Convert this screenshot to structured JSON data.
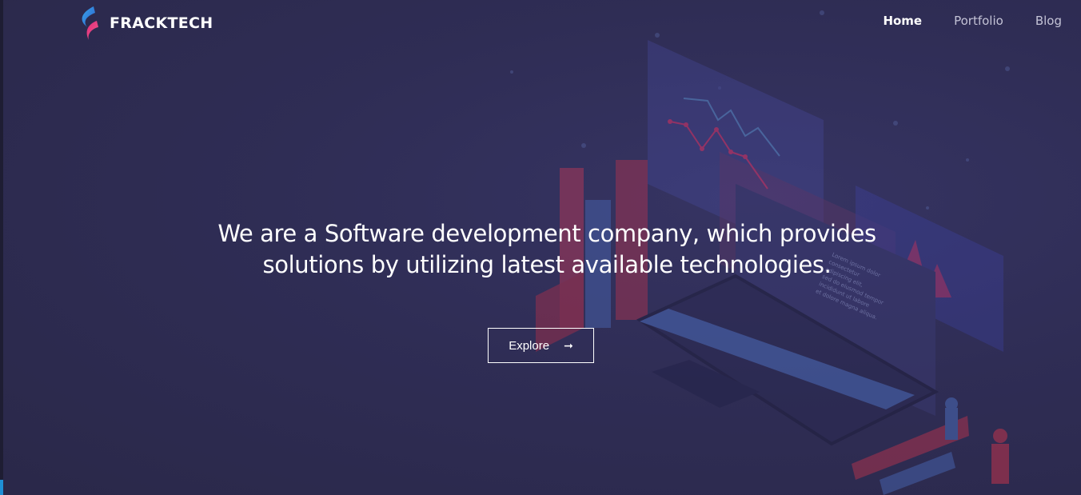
{
  "brand": {
    "name": "FRACKTECH",
    "colors": {
      "background": "#2d2b4e",
      "accent_blue": "#2b7bd6",
      "accent_pink": "#e0246a"
    }
  },
  "nav": {
    "items": [
      {
        "label": "Home",
        "active": true
      },
      {
        "label": "Portfolio",
        "active": false
      },
      {
        "label": "Blog",
        "active": false
      }
    ]
  },
  "hero": {
    "line1": "We are a Software development company, which provides",
    "line2": "solutions by utilizing latest available technologies.",
    "cta_label": "Explore",
    "cta_icon": "arrow-right-icon"
  },
  "illustration": {
    "name": "isometric-laptop-analytics",
    "screen_text": [
      "Lorem ipsum dolor",
      "consectetur",
      "adipiscing elit,",
      "sed do eiusmod tempor",
      "incididunt ut labore",
      "et dolore magna aliqua."
    ]
  }
}
